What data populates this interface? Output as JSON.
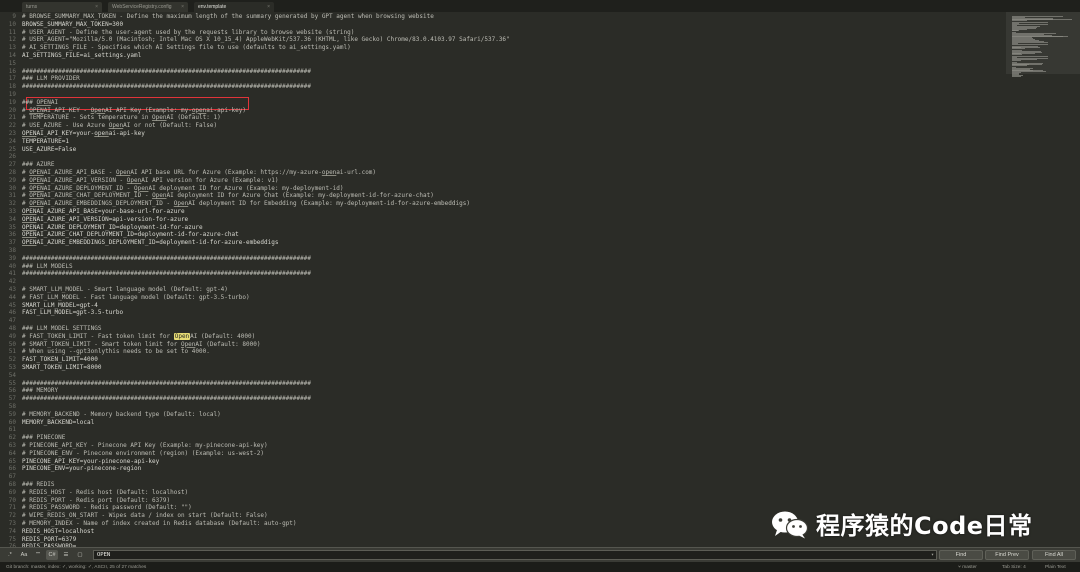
{
  "tabs": [
    {
      "label": "turns",
      "active": false
    },
    {
      "label": "WebServiceRegistry.config",
      "active": false
    },
    {
      "label": "env.template",
      "active": true
    }
  ],
  "editor": {
    "search_term": "OPEN",
    "lines": [
      {
        "n": "9",
        "text": "# BROWSE_SUMMARY_MAX_TOKEN - Define the maximum length of the summary generated by GPT agent when browsing website",
        "kind": "comment"
      },
      {
        "n": "10",
        "text": "BROWSE_SUMMARY_MAX_TOKEN=300",
        "kind": "code"
      },
      {
        "n": "11",
        "text": "# USER_AGENT - Define the user-agent used by the requests library to browse website (string)",
        "kind": "comment"
      },
      {
        "n": "12",
        "text": "# USER_AGENT=\"Mozilla/5.0 (Macintosh; Intel Mac OS X 10_15_4) AppleWebKit/537.36 (KHTML, like Gecko) Chrome/83.0.4103.97 Safari/537.36\"",
        "kind": "comment"
      },
      {
        "n": "13",
        "text": "# AI_SETTINGS_FILE - Specifies which AI Settings file to use (defaults to ai_settings.yaml)",
        "kind": "comment"
      },
      {
        "n": "14",
        "text": "AI_SETTINGS_FILE=ai_settings.yaml",
        "kind": "code"
      },
      {
        "n": "15",
        "text": "",
        "kind": "code"
      },
      {
        "n": "16",
        "text": "################################################################################",
        "kind": "comment"
      },
      {
        "n": "17",
        "text": "### LLM PROVIDER",
        "kind": "comment"
      },
      {
        "n": "18",
        "text": "################################################################################",
        "kind": "comment"
      },
      {
        "n": "19",
        "text": "",
        "kind": "code"
      },
      {
        "n": "19",
        "text": "### OPENAI",
        "kind": "comment"
      },
      {
        "n": "20",
        "text": "# OPENAI_API_KEY - OpenAI API Key (Example: my-openai-api-key)",
        "kind": "comment"
      },
      {
        "n": "21",
        "text": "# TEMPERATURE - Sets temperature in OpenAI (Default: 1)",
        "kind": "comment"
      },
      {
        "n": "22",
        "text": "# USE_AZURE - Use Azure OpenAI or not (Default: False)",
        "kind": "comment"
      },
      {
        "n": "23",
        "text": "OPENAI_API_KEY=your-openai-api-key",
        "kind": "code"
      },
      {
        "n": "24",
        "text": "TEMPERATURE=1",
        "kind": "code"
      },
      {
        "n": "25",
        "text": "USE_AZURE=False",
        "kind": "code"
      },
      {
        "n": "26",
        "text": "",
        "kind": "code"
      },
      {
        "n": "27",
        "text": "### AZURE",
        "kind": "comment"
      },
      {
        "n": "28",
        "text": "# OPENAI_AZURE_API_BASE - OpenAI API base URL for Azure (Example: https://my-azure-openai-url.com)",
        "kind": "comment"
      },
      {
        "n": "29",
        "text": "# OPENAI_AZURE_API_VERSION - OpenAI API version for Azure (Example: v1)",
        "kind": "comment"
      },
      {
        "n": "30",
        "text": "# OPENAI_AZURE_DEPLOYMENT_ID - OpenAI deployment ID for Azure (Example: my-deployment-id)",
        "kind": "comment"
      },
      {
        "n": "31",
        "text": "# OPENAI_AZURE_CHAT_DEPLOYMENT_ID - OpenAI deployment ID for Azure Chat (Example: my-deployment-id-for-azure-chat)",
        "kind": "comment"
      },
      {
        "n": "32",
        "text": "# OPENAI_AZURE_EMBEDDINGS_DEPLOYMENT_ID - OpenAI deployment ID for Embedding (Example: my-deployment-id-for-azure-embeddigs)",
        "kind": "comment"
      },
      {
        "n": "33",
        "text": "OPENAI_AZURE_API_BASE=your-base-url-for-azure",
        "kind": "code"
      },
      {
        "n": "34",
        "text": "OPENAI_AZURE_API_VERSION=api-version-for-azure",
        "kind": "code"
      },
      {
        "n": "35",
        "text": "OPENAI_AZURE_DEPLOYMENT_ID=deployment-id-for-azure",
        "kind": "code"
      },
      {
        "n": "36",
        "text": "OPENAI_AZURE_CHAT_DEPLOYMENT_ID=deployment-id-for-azure-chat",
        "kind": "code"
      },
      {
        "n": "37",
        "text": "OPENAI_AZURE_EMBEDDINGS_DEPLOYMENT_ID=deployment-id-for-azure-embeddigs",
        "kind": "code"
      },
      {
        "n": "38",
        "text": "",
        "kind": "code"
      },
      {
        "n": "39",
        "text": "################################################################################",
        "kind": "comment"
      },
      {
        "n": "40",
        "text": "### LLM MODELS",
        "kind": "comment"
      },
      {
        "n": "41",
        "text": "################################################################################",
        "kind": "comment"
      },
      {
        "n": "42",
        "text": "",
        "kind": "code"
      },
      {
        "n": "43",
        "text": "# SMART_LLM_MODEL - Smart language model (Default: gpt-4)",
        "kind": "comment"
      },
      {
        "n": "44",
        "text": "# FAST_LLM_MODEL - Fast language model (Default: gpt-3.5-turbo)",
        "kind": "comment"
      },
      {
        "n": "45",
        "text": "SMART_LLM_MODEL=gpt-4",
        "kind": "code"
      },
      {
        "n": "46",
        "text": "FAST_LLM_MODEL=gpt-3.5-turbo",
        "kind": "code"
      },
      {
        "n": "47",
        "text": "",
        "kind": "code"
      },
      {
        "n": "48",
        "text": "### LLM MODEL SETTINGS",
        "kind": "comment"
      },
      {
        "n": "49",
        "text": "# FAST_TOKEN_LIMIT - Fast token limit for OpenAI (Default: 4000)",
        "kind": "comment"
      },
      {
        "n": "50",
        "text": "# SMART_TOKEN_LIMIT - Smart token limit for OpenAI (Default: 8000)",
        "kind": "comment"
      },
      {
        "n": "51",
        "text": "# When using --gpt3onlythis needs to be set to 4000.",
        "kind": "comment"
      },
      {
        "n": "52",
        "text": "FAST_TOKEN_LIMIT=4000",
        "kind": "code"
      },
      {
        "n": "53",
        "text": "SMART_TOKEN_LIMIT=8000",
        "kind": "code"
      },
      {
        "n": "54",
        "text": "",
        "kind": "code"
      },
      {
        "n": "55",
        "text": "################################################################################",
        "kind": "comment"
      },
      {
        "n": "56",
        "text": "### MEMORY",
        "kind": "comment"
      },
      {
        "n": "57",
        "text": "################################################################################",
        "kind": "comment"
      },
      {
        "n": "58",
        "text": "",
        "kind": "code"
      },
      {
        "n": "59",
        "text": "# MEMORY_BACKEND - Memory backend type (Default: local)",
        "kind": "comment"
      },
      {
        "n": "60",
        "text": "MEMORY_BACKEND=local",
        "kind": "code"
      },
      {
        "n": "61",
        "text": "",
        "kind": "code"
      },
      {
        "n": "62",
        "text": "### PINECONE",
        "kind": "comment"
      },
      {
        "n": "63",
        "text": "# PINECONE_API_KEY - Pinecone API Key (Example: my-pinecone-api-key)",
        "kind": "comment"
      },
      {
        "n": "64",
        "text": "# PINECONE_ENV - Pinecone environment (region) (Example: us-west-2)",
        "kind": "comment"
      },
      {
        "n": "65",
        "text": "PINECONE_API_KEY=your-pinecone-api-key",
        "kind": "code"
      },
      {
        "n": "66",
        "text": "PINECONE_ENV=your-pinecone-region",
        "kind": "code"
      },
      {
        "n": "67",
        "text": "",
        "kind": "code"
      },
      {
        "n": "68",
        "text": "### REDIS",
        "kind": "comment"
      },
      {
        "n": "69",
        "text": "# REDIS_HOST - Redis host (Default: localhost)",
        "kind": "comment"
      },
      {
        "n": "70",
        "text": "# REDIS_PORT - Redis port (Default: 6379)",
        "kind": "comment"
      },
      {
        "n": "71",
        "text": "# REDIS_PASSWORD - Redis password (Default: \"\")",
        "kind": "comment"
      },
      {
        "n": "72",
        "text": "# WIPE_REDIS_ON_START - Wipes data / index on start (Default: False)",
        "kind": "comment"
      },
      {
        "n": "73",
        "text": "# MEMORY_INDEX - Name of index created in Redis database (Default: auto-gpt)",
        "kind": "comment"
      },
      {
        "n": "74",
        "text": "REDIS_HOST=localhost",
        "kind": "code"
      },
      {
        "n": "75",
        "text": "REDIS_PORT=6379",
        "kind": "code"
      },
      {
        "n": "76",
        "text": "REDIS_PASSWORD=",
        "kind": "code"
      },
      {
        "n": "77",
        "text": "WIPE_REDIS_ON_START=False",
        "kind": "code"
      },
      {
        "n": "78",
        "text": "MEMORY_INDEX=auto-gpt",
        "kind": "code"
      }
    ]
  },
  "findbar": {
    "options": [
      ".*",
      "Aa",
      "\"\"",
      "C#",
      "☰",
      "▢"
    ],
    "query": "OPEN",
    "find_label": "Find",
    "find_prev_label": "Find Prev",
    "find_all_label": "Find All"
  },
  "statusbar": {
    "left": "Git branch: master, index: ✓, working: ✓, ASCII, 25 of 27 matches",
    "branch": "master",
    "tab_size": "Tab Size: 4",
    "syntax": "Plain Text"
  },
  "watermark": {
    "text": "程序猿的Code日常"
  }
}
